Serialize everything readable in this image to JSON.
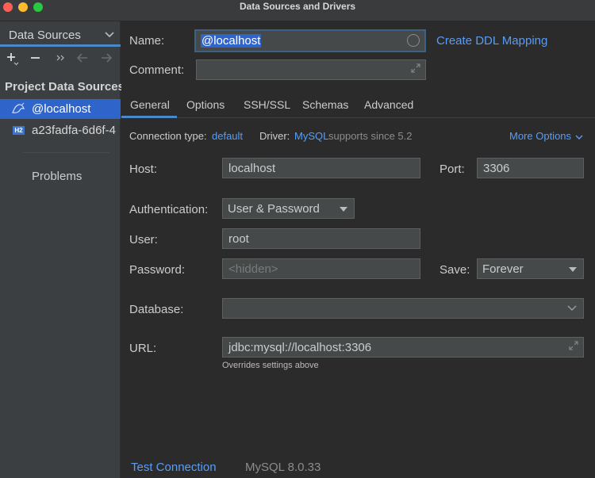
{
  "window": {
    "title": "Data Sources and Drivers"
  },
  "sidebar": {
    "header": "Data Sources",
    "section_title": "Project Data Sources",
    "items": [
      {
        "label": "@localhost",
        "icon": "mysql-icon",
        "selected": true
      },
      {
        "label": "a23fadfa-6d6f-4",
        "icon": "h2-icon",
        "badge": "H2",
        "selected": false
      }
    ],
    "problems": "Problems"
  },
  "form": {
    "name_label": "Name:",
    "name_value": "@localhost",
    "create_ddl_link": "Create DDL Mapping",
    "comment_label": "Comment:",
    "comment_value": ""
  },
  "tabs": [
    "General",
    "Options",
    "SSH/SSL",
    "Schemas",
    "Advanced"
  ],
  "connection": {
    "type_label": "Connection type:",
    "type_value": "default",
    "driver_label": "Driver:",
    "driver_value": "MySQL",
    "driver_note": "supports since 5.2",
    "more_options": "More Options"
  },
  "general": {
    "host_label": "Host:",
    "host_value": "localhost",
    "port_label": "Port:",
    "port_value": "3306",
    "auth_label": "Authentication:",
    "auth_value": "User & Password",
    "user_label": "User:",
    "user_value": "root",
    "password_label": "Password:",
    "password_placeholder": "<hidden>",
    "save_label": "Save:",
    "save_value": "Forever",
    "database_label": "Database:",
    "database_value": "",
    "url_label": "URL:",
    "url_value": "jdbc:mysql://localhost:3306",
    "url_hint": "Overrides settings above"
  },
  "footer": {
    "test_connection": "Test Connection",
    "version": "MySQL 8.0.33"
  },
  "colors": {
    "accent": "#2f65ca",
    "link": "#589df6",
    "background": "#2b2b2b",
    "sidebar": "#3c3f41"
  }
}
